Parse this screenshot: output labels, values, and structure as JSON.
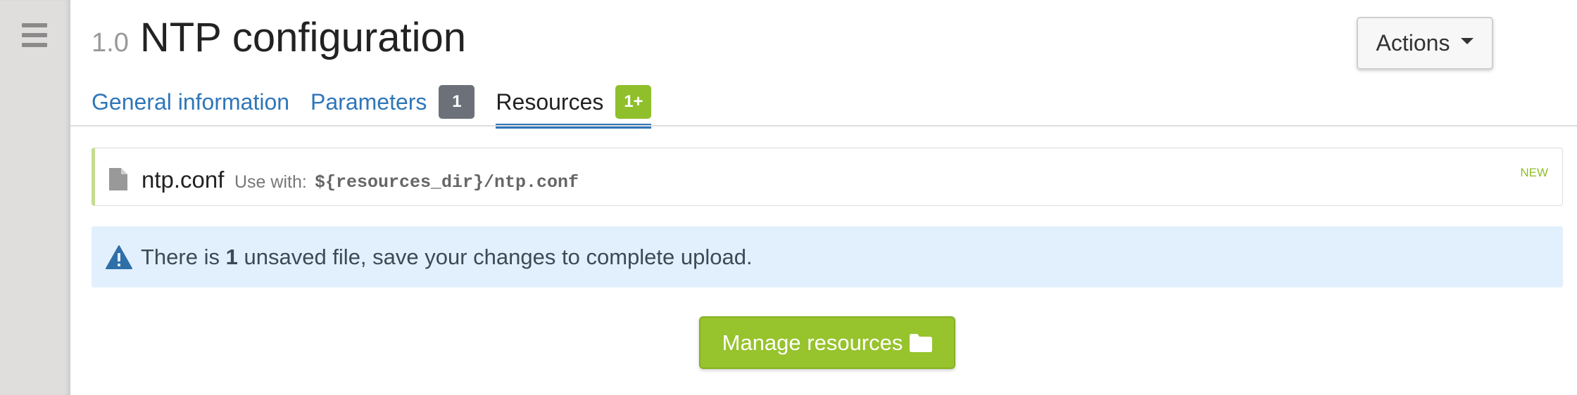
{
  "header": {
    "version": "1.0",
    "title": "NTP configuration",
    "actions_label": "Actions"
  },
  "tabs": [
    {
      "label": "General information",
      "badge": null,
      "active": false
    },
    {
      "label": "Parameters",
      "badge": "1",
      "active": false
    },
    {
      "label": "Resources",
      "badge": "1+",
      "active": true
    }
  ],
  "resource_file": {
    "name": "ntp.conf",
    "use_with_label": "Use with:",
    "path": "${resources_dir}/ntp.conf",
    "status": "NEW"
  },
  "alert": {
    "text_before": "There is",
    "count": "1",
    "text_after": "unsaved file, save your changes to complete upload."
  },
  "manage_button": {
    "label": "Manage resources"
  },
  "colors": {
    "link_blue": "#2f76b9",
    "badge_gray": "#6c7179",
    "badge_green": "#8fbf2a",
    "alert_bg": "#e1f0fc",
    "button_green": "#97c32c"
  },
  "icons": {
    "menu": "hamburger-icon",
    "file": "file-icon",
    "warning": "warning-icon",
    "folder": "folder-icon",
    "dropdown": "caret-down-icon"
  }
}
